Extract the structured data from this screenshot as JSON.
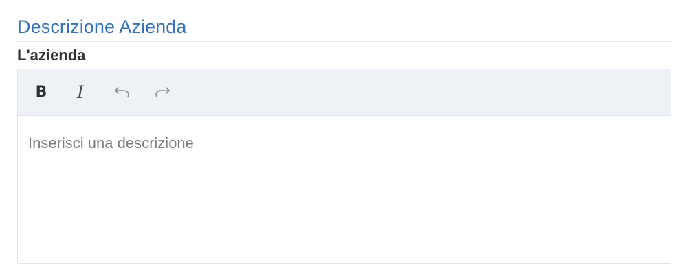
{
  "section": {
    "title": "Descrizione Azienda"
  },
  "field": {
    "label": "L'azienda"
  },
  "editor": {
    "toolbar": {
      "bold_label": "B",
      "italic_label": "I",
      "undo_icon": "undo-icon",
      "redo_icon": "redo-icon"
    },
    "placeholder": "Inserisci una descrizione"
  },
  "colors": {
    "title": "#3573b9",
    "label": "#2f3337",
    "toolbar_bg": "#eef2f6",
    "border": "#dfe4ea",
    "placeholder": "#7b7f84",
    "icon_muted": "#8a8f95"
  }
}
